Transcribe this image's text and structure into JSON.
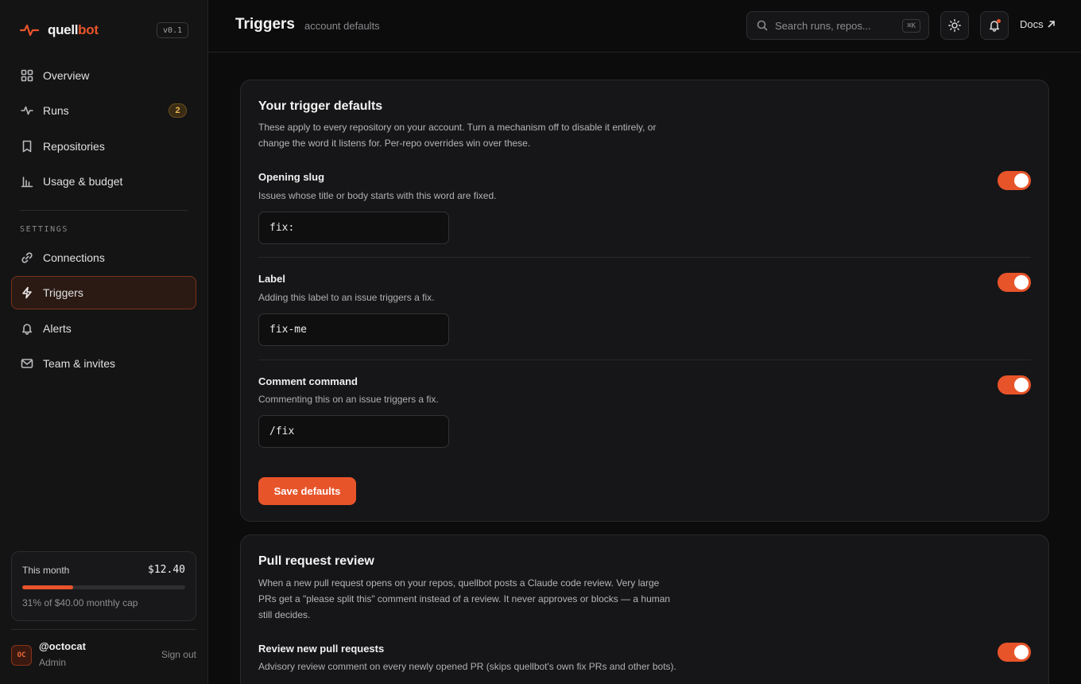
{
  "brand": {
    "name_part1": "quell",
    "name_part2": "bot",
    "version": "v0.1",
    "accent": "#e8542a"
  },
  "sidebar": {
    "nav": [
      {
        "label": "Overview",
        "icon": "grid-icon"
      },
      {
        "label": "Runs",
        "icon": "activity-icon",
        "badge": "2"
      },
      {
        "label": "Repositories",
        "icon": "book-icon"
      },
      {
        "label": "Usage & budget",
        "icon": "bar-chart-icon"
      }
    ],
    "settings_label": "SETTINGS",
    "settings": [
      {
        "label": "Connections",
        "icon": "link-icon"
      },
      {
        "label": "Triggers",
        "icon": "zap-icon",
        "active": true
      },
      {
        "label": "Alerts",
        "icon": "bell-icon"
      },
      {
        "label": "Team & invites",
        "icon": "mail-icon"
      }
    ],
    "budget": {
      "label": "This month",
      "amount": "$12.40",
      "percent": 31,
      "caption": "31% of $40.00 monthly cap"
    },
    "user": {
      "initials": "OC",
      "name": "@octocat",
      "role": "Admin",
      "sign_out": "Sign out"
    }
  },
  "header": {
    "title": "Triggers",
    "subtitle": "account defaults",
    "search_placeholder": "Search runs, repos...",
    "search_shortcut": "⌘K",
    "docs_label": "Docs"
  },
  "trigger_defaults": {
    "title": "Your trigger defaults",
    "description": "These apply to every repository on your account. Turn a mechanism off to disable it entirely, or change the word it listens for. Per-repo overrides win over these.",
    "fields": [
      {
        "title": "Opening slug",
        "description": "Issues whose title or body starts with this word are fixed.",
        "value": "fix:",
        "enabled": true
      },
      {
        "title": "Label",
        "description": "Adding this label to an issue triggers a fix.",
        "value": "fix-me",
        "enabled": true
      },
      {
        "title": "Comment command",
        "description": "Commenting this on an issue triggers a fix.",
        "value": "/fix",
        "enabled": true
      }
    ],
    "save_label": "Save defaults"
  },
  "pr_review": {
    "title": "Pull request review",
    "description": "When a new pull request opens on your repos, quellbot posts a Claude code review. Very large PRs get a \"please split this\" comment instead of a review. It never approves or blocks — a human still decides.",
    "toggle_title": "Review new pull requests",
    "toggle_description": "Advisory review comment on every newly opened PR (skips quellbot's own fix PRs and other bots).",
    "enabled": true
  }
}
